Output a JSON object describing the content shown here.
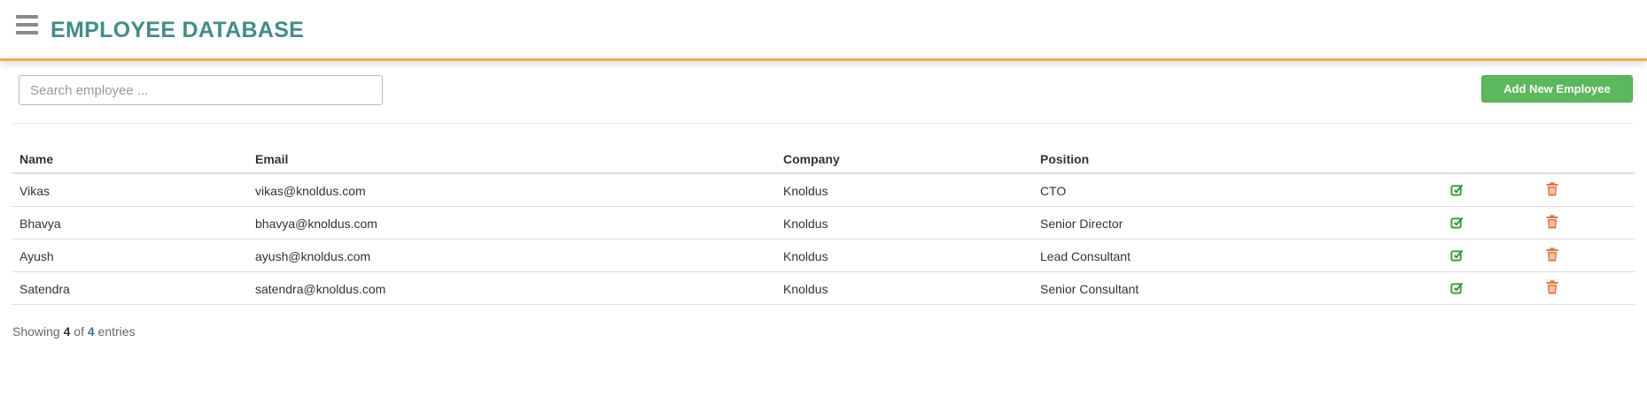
{
  "header": {
    "title": "EMPLOYEE DATABASE",
    "menu_icon": "hamburger-icon",
    "accent_color": "#f0ad4e",
    "title_color": "#3e8e88"
  },
  "toolbar": {
    "search_placeholder": "Search employee ...",
    "search_value": "",
    "add_button_label": "Add New Employee",
    "add_button_color": "#5cb85c"
  },
  "table": {
    "columns": [
      "Name",
      "Email",
      "Company",
      "Position"
    ],
    "rows": [
      {
        "name": "Vikas",
        "email": "vikas@knoldus.com",
        "company": "Knoldus",
        "position": "CTO"
      },
      {
        "name": "Bhavya",
        "email": "bhavya@knoldus.com",
        "company": "Knoldus",
        "position": "Senior Director"
      },
      {
        "name": "Ayush",
        "email": "ayush@knoldus.com",
        "company": "Knoldus",
        "position": "Lead Consultant"
      },
      {
        "name": "Satendra",
        "email": "satendra@knoldus.com",
        "company": "Knoldus",
        "position": "Senior Consultant"
      }
    ],
    "row_actions": {
      "edit_icon": "edit-icon",
      "edit_color": "#2e9b3a",
      "delete_icon": "trash-icon",
      "delete_color": "#e8743b"
    }
  },
  "footer": {
    "showing_prefix": "Showing",
    "shown_count": "4",
    "of_word": "of",
    "total_count": "4",
    "suffix": "entries"
  }
}
